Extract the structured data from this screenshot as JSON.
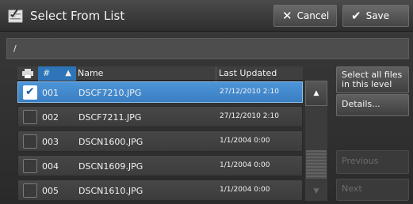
{
  "header": {
    "title": "Select From List",
    "cancel_label": "Cancel",
    "save_label": "Save"
  },
  "path": "/",
  "list": {
    "columns": {
      "number": "#",
      "name": "Name",
      "last_updated": "Last Updated"
    },
    "sort": "ascending",
    "rows": [
      {
        "number": "001",
        "name": "DSCF7210.JPG",
        "date": "27/12/2010 2:10",
        "selected": true
      },
      {
        "number": "002",
        "name": "DSCF7211.JPG",
        "date": "27/12/2010 2:10",
        "selected": false
      },
      {
        "number": "003",
        "name": "DSCN1600.JPG",
        "date": "1/1/2004 0:00",
        "selected": false
      },
      {
        "number": "004",
        "name": "DSCN1609.JPG",
        "date": "1/1/2004 0:00",
        "selected": false
      },
      {
        "number": "005",
        "name": "DSCN1610.JPG",
        "date": "1/1/2004 0:00",
        "selected": false
      }
    ]
  },
  "side": {
    "select_all_label_line1": "Select all files",
    "select_all_label_line2": "in this level",
    "details_label": "Details...",
    "previous_label": "Previous",
    "next_label": "Next"
  },
  "icons": {
    "title": "checklist-icon",
    "cancel": "close-icon",
    "save": "checkmark-icon",
    "header": "printer-icon",
    "sort": "sort-ascending-icon"
  },
  "colors": {
    "accent_blue": "#3a7fc2",
    "header_sort_blue": "#2d75b8",
    "background": "#2b2b2b"
  }
}
